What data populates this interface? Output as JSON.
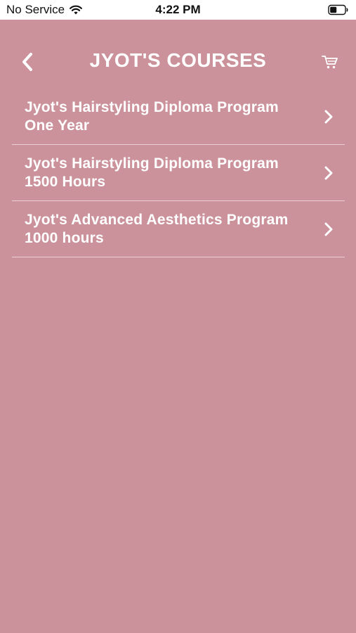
{
  "status_bar": {
    "carrier": "No Service",
    "time": "4:22 PM",
    "wifi_icon": "wifi-icon",
    "battery_icon": "battery-icon"
  },
  "header": {
    "title": "JYOT'S COURSES",
    "back_icon": "chevron-left-icon",
    "cart_icon": "cart-icon"
  },
  "courses": [
    {
      "title": "Jyot's Hairstyling Diploma Program One Year"
    },
    {
      "title": "Jyot's Hairstyling Diploma Program 1500 Hours"
    },
    {
      "title": "Jyot's Advanced Aesthetics Program 1000 hours"
    }
  ],
  "colors": {
    "background": "#cb929b",
    "text": "#ffffff",
    "divider": "#e8d0d4",
    "status_bar_bg": "#ffffff"
  }
}
